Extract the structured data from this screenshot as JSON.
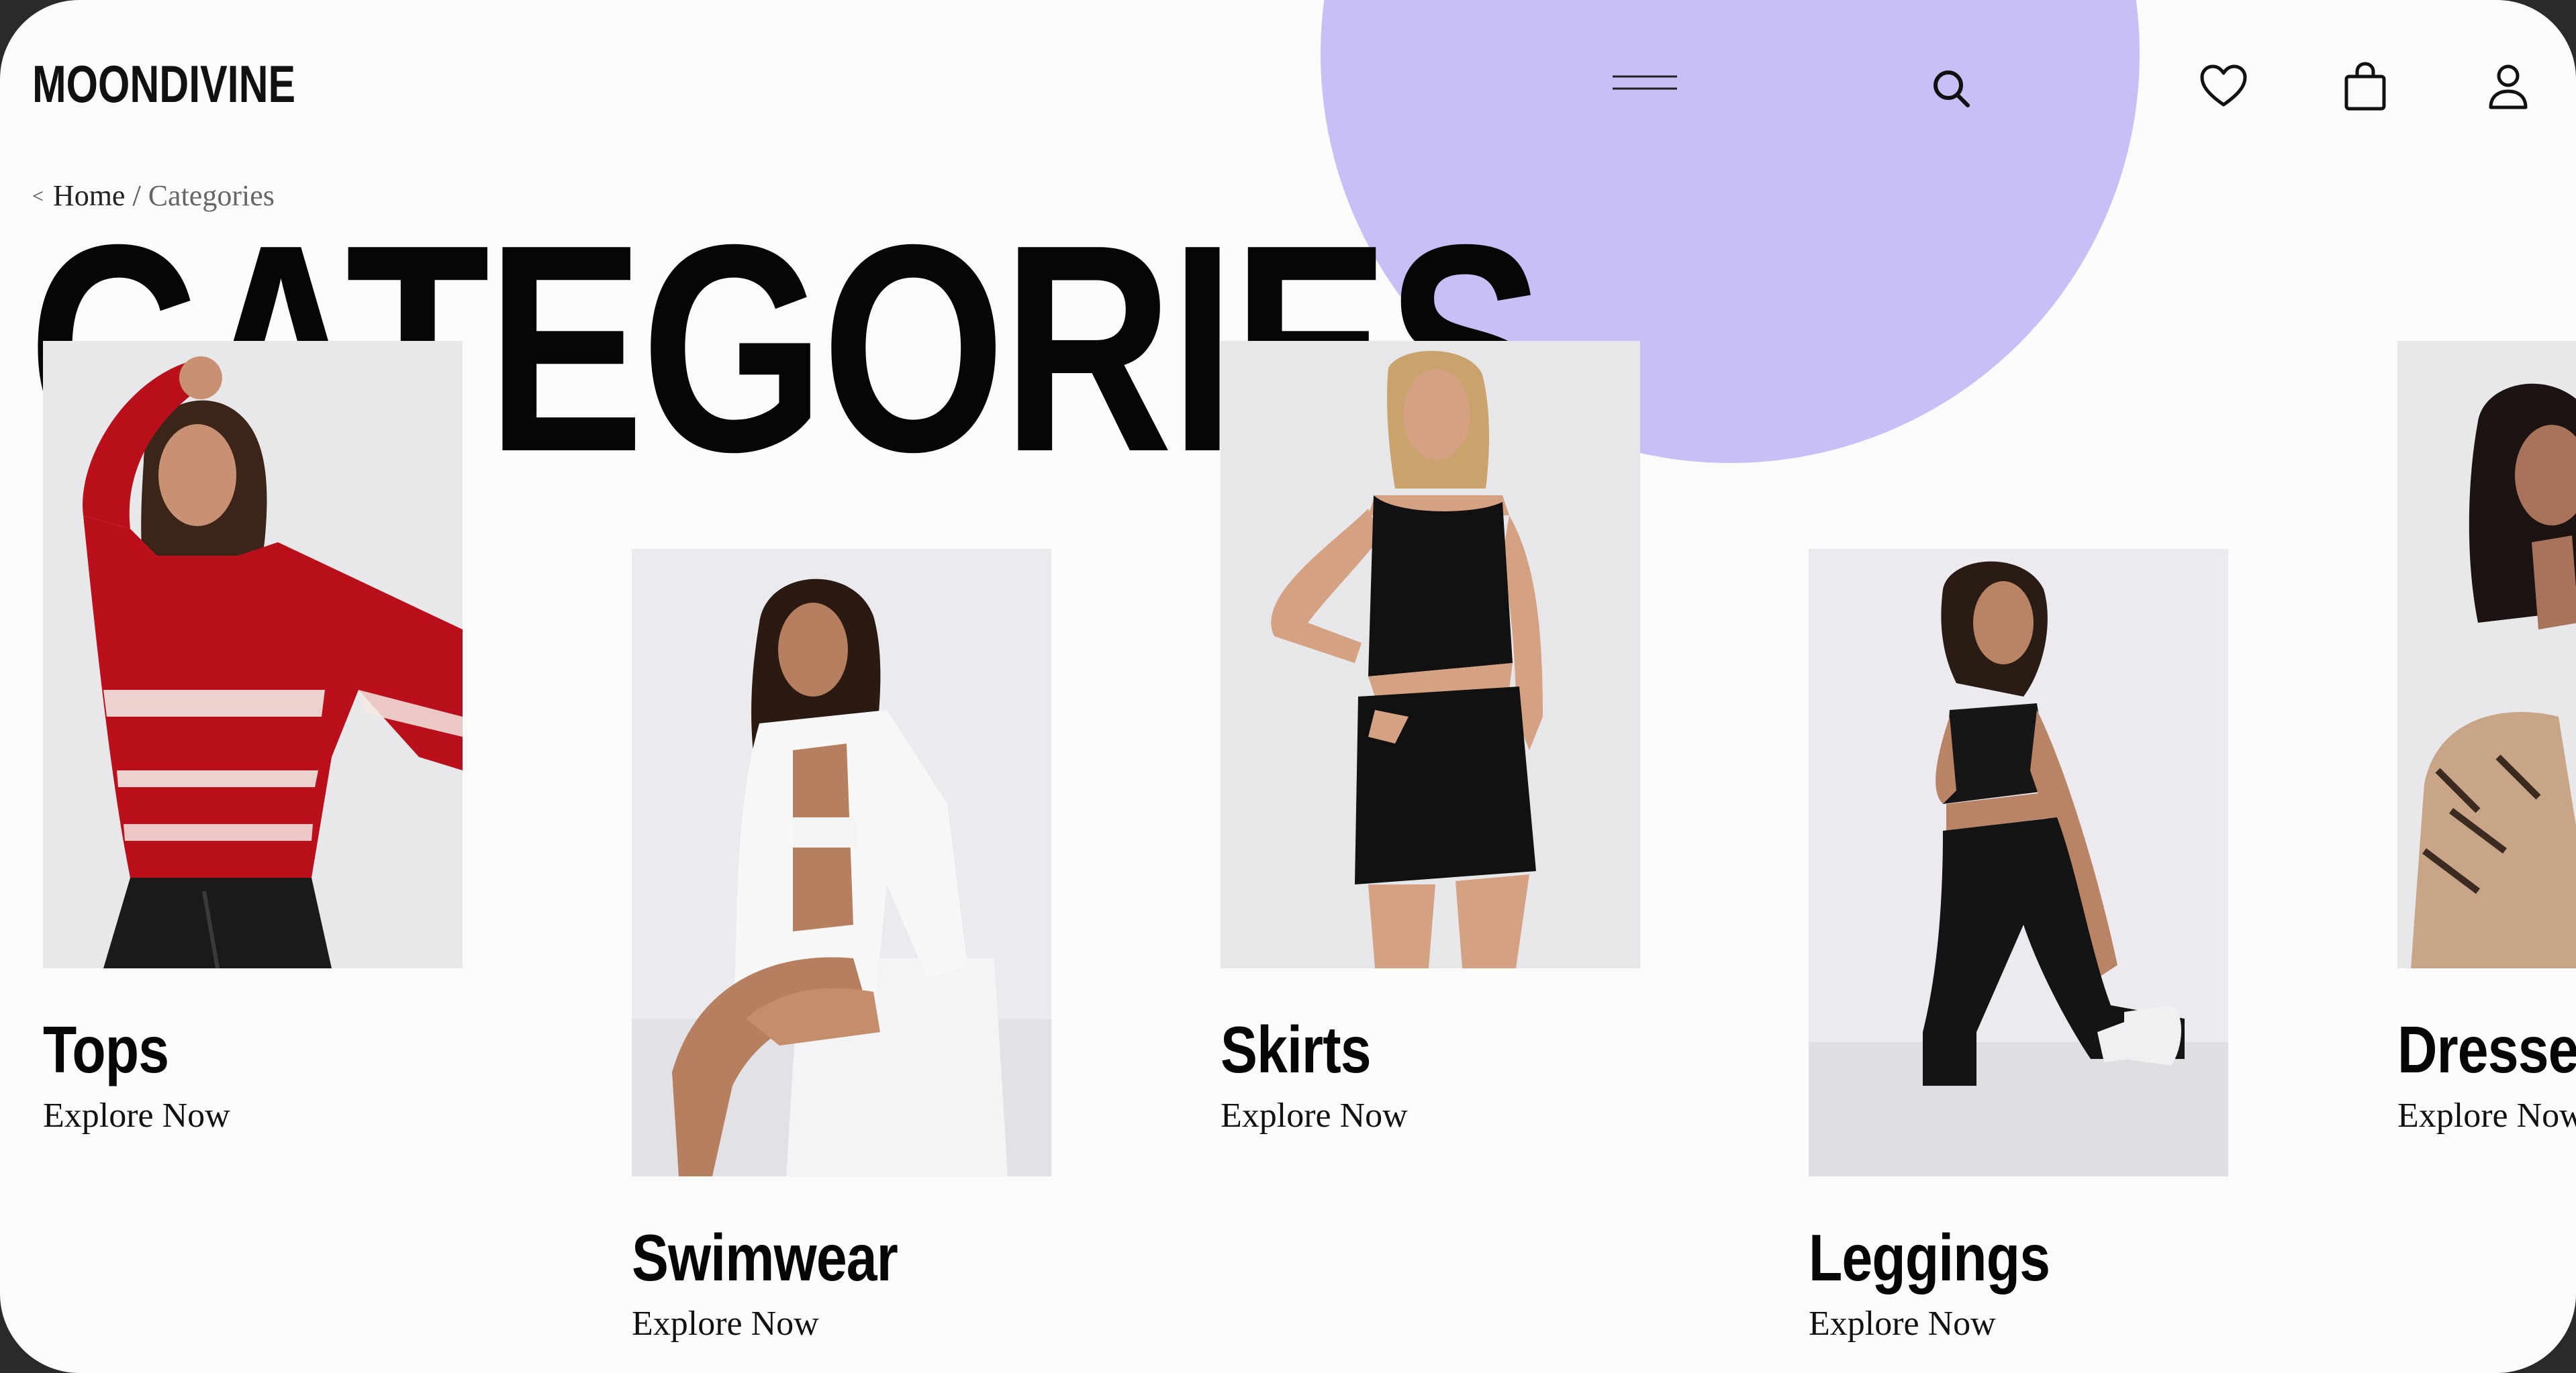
{
  "brand": {
    "logo": "MOONDIVINE"
  },
  "nav": {
    "icons": [
      "menu-icon",
      "search-icon",
      "heart-icon",
      "bag-icon",
      "user-icon"
    ]
  },
  "breadcrumb": {
    "back": "<",
    "home": "Home",
    "separator": "/",
    "current": "Categories"
  },
  "page": {
    "title": "CATEGORIES"
  },
  "categories": [
    {
      "title": "Tops",
      "cta": "Explore Now"
    },
    {
      "title": "Swimwear",
      "cta": "Explore Now"
    },
    {
      "title": "Skirts",
      "cta": "Explore Now"
    },
    {
      "title": "Leggings",
      "cta": "Explore Now"
    },
    {
      "title": "Dresses",
      "cta": "Explore Now"
    }
  ],
  "colors": {
    "background": "#fcfbfc",
    "accent_blob": "#c7bff5",
    "text": "#060606",
    "photo_bg": "#e7e6e9"
  }
}
